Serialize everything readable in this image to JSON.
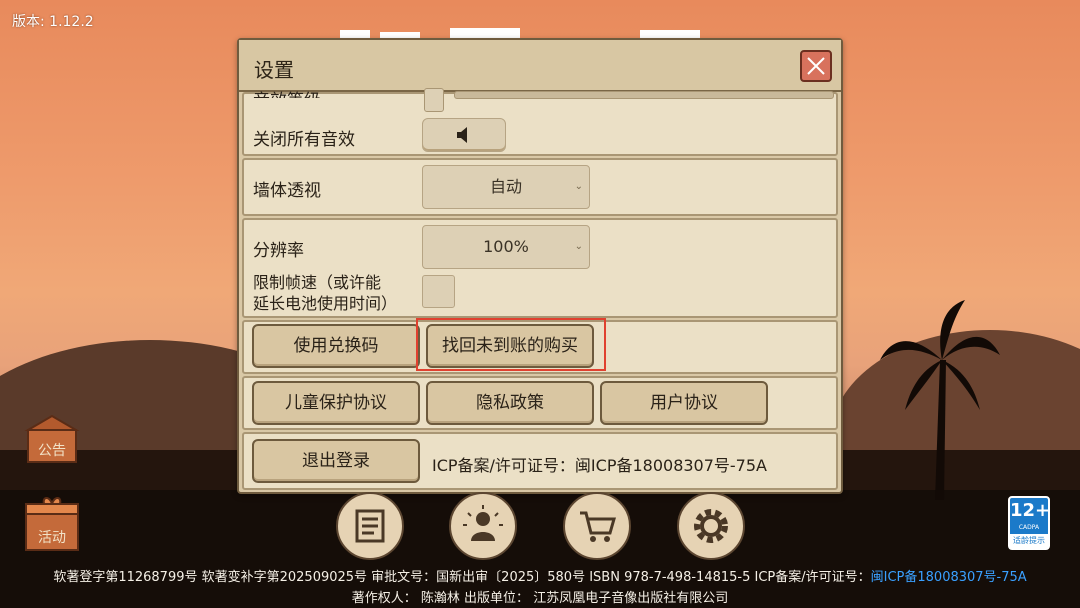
{
  "version": "版本: 1.12.2",
  "dialog": {
    "title": "设置",
    "partial_label": "音效等级",
    "mute_all_label": "关闭所有音效",
    "wall_xray_label": "墙体透视",
    "wall_xray_value": "自动",
    "resolution_label": "分辨率",
    "resolution_value": "100%",
    "fps_limit_label_line1": "限制帧速（或许能",
    "fps_limit_label_line2": "延长电池使用时间）",
    "redeem_code_label": "使用兑换码",
    "restore_purchase_label": "找回未到账的购买",
    "child_protection_label": "儿童保护协议",
    "privacy_label": "隐私政策",
    "user_agreement_label": "用户协议",
    "logout_label": "退出登录",
    "icp_text": "ICP备案/许可证号：闽ICP备18008307号-75A"
  },
  "left_buttons": {
    "announcement": "公告",
    "events": "活动"
  },
  "bottom_nav": [
    "scroll-icon",
    "hero-icon",
    "cart-icon",
    "settings-gear-icon"
  ],
  "age_rating": {
    "number": "12+",
    "cadpa": "CADPA",
    "tip": "适龄提示"
  },
  "footer": {
    "line1_text": "软著登字第11268799号 软著变补字第202509025号 审批文号：国新出审〔2025〕580号 ISBN 978-7-498-14815-5 ICP备案/许可证号：",
    "line1_link": "闽ICP备18008307号-75A",
    "line2": "著作权人：  陈瀚林  出版单位：  江苏凤凰电子音像出版社有限公司"
  },
  "colors": {
    "dialog_bg": "#d9c8a6",
    "section_bg": "#ebe0c6",
    "close_button": "#d8725d",
    "highlight_box": "#e0412f",
    "footer_link": "#3aa0ff",
    "age_badge": "#1b7ac9"
  }
}
